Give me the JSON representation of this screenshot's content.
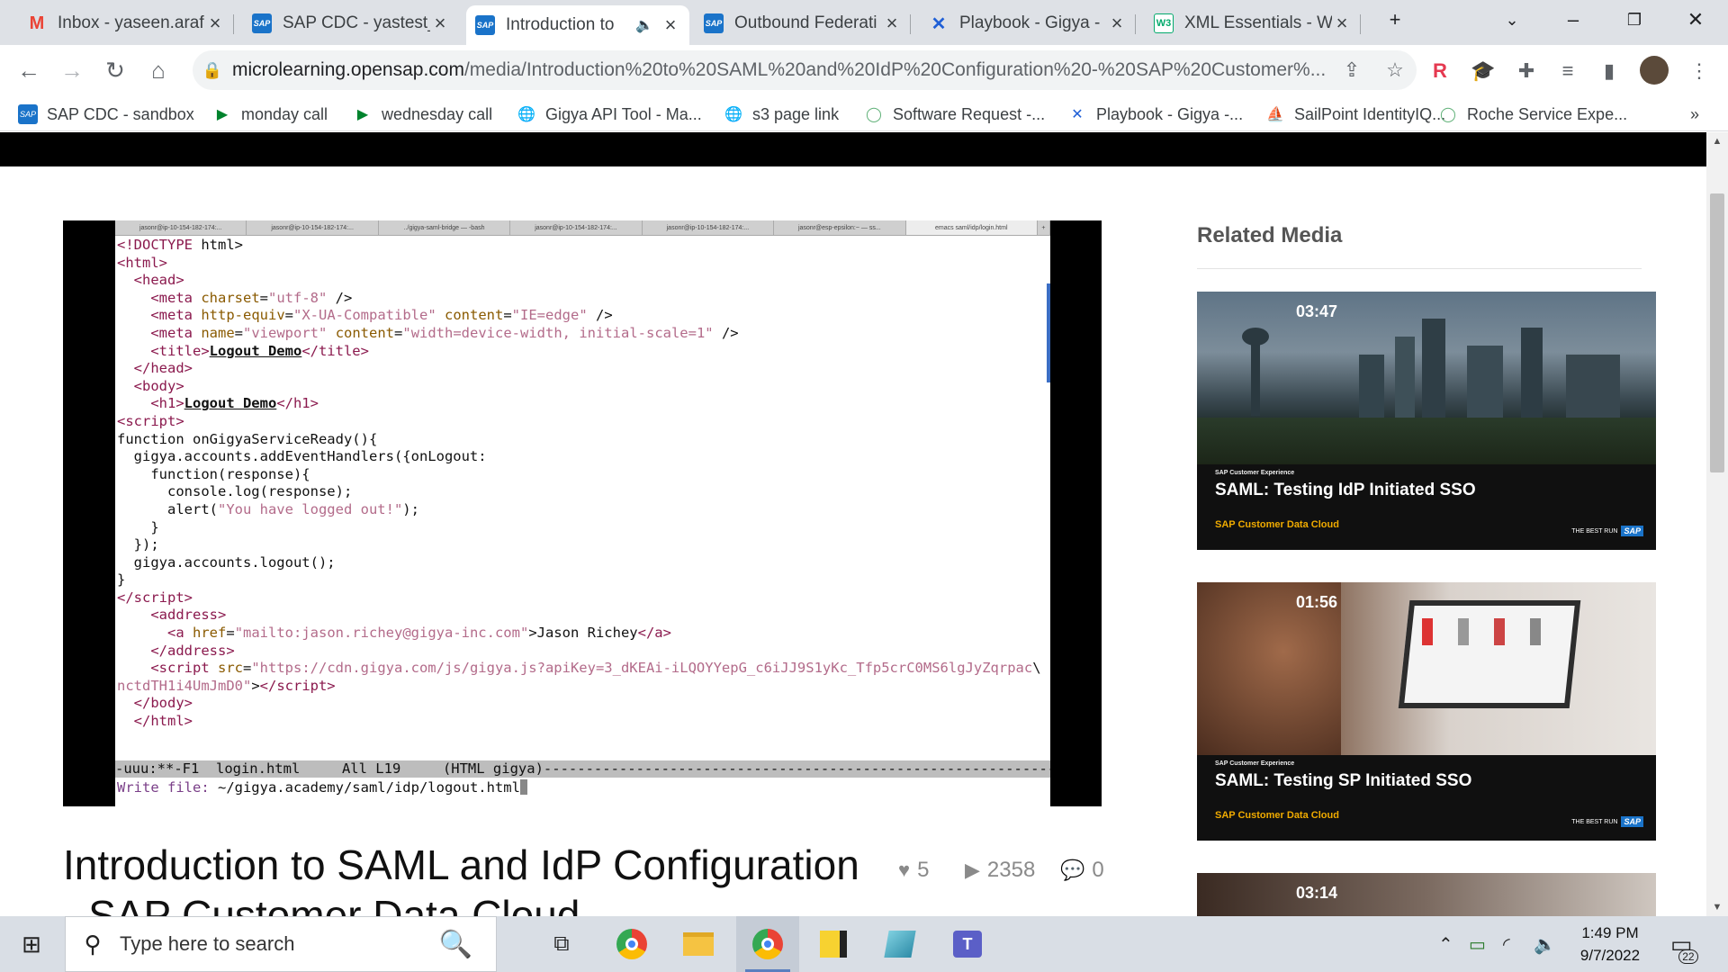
{
  "browser": {
    "tabs": [
      {
        "icon": "gmail-icon",
        "title": "Inbox - yaseen.araf",
        "active": false
      },
      {
        "icon": "sap-icon",
        "title": "SAP CDC - yastest_",
        "active": false
      },
      {
        "icon": "sap-icon",
        "title": "Introduction to",
        "active": true
      },
      {
        "icon": "sap-icon",
        "title": "Outbound Federati",
        "active": false
      },
      {
        "icon": "confluence-icon",
        "title": "Playbook - Gigya -",
        "active": false
      },
      {
        "icon": "w3schools-icon",
        "title": "XML Essentials - W",
        "active": false
      }
    ],
    "url_host": "microlearning.opensap.com",
    "url_path": "/media/Introduction%20to%20SAML%20and%20IdP%20Configuration%20-%20SAP%20Customer%...",
    "bookmarks": [
      {
        "icon": "sap-icon",
        "label": "SAP CDC - sandbox"
      },
      {
        "icon": "meet-icon",
        "label": "monday call"
      },
      {
        "icon": "meet-icon",
        "label": "wednesday call"
      },
      {
        "icon": "globe-icon",
        "label": "Gigya API Tool - Ma..."
      },
      {
        "icon": "globe-icon",
        "label": "s3 page link"
      },
      {
        "icon": "circle-icon",
        "label": "Software Request -..."
      },
      {
        "icon": "confluence-icon",
        "label": "Playbook - Gigya -..."
      },
      {
        "icon": "sailpoint-icon",
        "label": "SailPoint IdentityIQ..."
      },
      {
        "icon": "circle-icon",
        "label": "Roche Service Expe..."
      }
    ],
    "extension_letter": "R"
  },
  "player": {
    "terminal_tabs": [
      "jasonr@ip-10-154-182-174:...",
      "jasonr@ip-10-154-182-174:...",
      "../gigya-saml-bridge — -bash",
      "jasonr@ip-10-154-182-174:...",
      "jasonr@ip-10-154-182-174:...",
      "jasonr@esp-epsilon:~ — ss...",
      "emacs saml/idp/login.html",
      "+"
    ],
    "modeline": "-uuu:**-F1  login.html     All L19     (HTML gigya)--------------------------------------------------------------------------",
    "minibuffer_prompt": "Write file: ",
    "minibuffer_value": "~/gigya.academy/saml/idp/logout.html"
  },
  "video": {
    "title": "Introduction to SAML and IdP Configuration",
    "title_line2": "- SAP Customer Data Cloud",
    "likes": "5",
    "plays": "2358",
    "comments": "0"
  },
  "related": {
    "heading": "Related Media",
    "items": [
      {
        "duration": "03:47",
        "small": "SAP Customer Experience",
        "title": "SAML: Testing IdP Initiated SSO",
        "brand": "SAP Customer Data Cloud",
        "tagline": "THE BEST RUN"
      },
      {
        "duration": "01:56",
        "small": "SAP Customer Experience",
        "title": "SAML: Testing SP Initiated SSO",
        "brand": "SAP Customer Data Cloud",
        "tagline": "THE BEST RUN"
      },
      {
        "duration": "03:14"
      }
    ],
    "sap_logo": "SAP"
  },
  "taskbar": {
    "search_placeholder": "Type here to search",
    "time": "1:49 PM",
    "date": "9/7/2022",
    "notifications": "22"
  }
}
